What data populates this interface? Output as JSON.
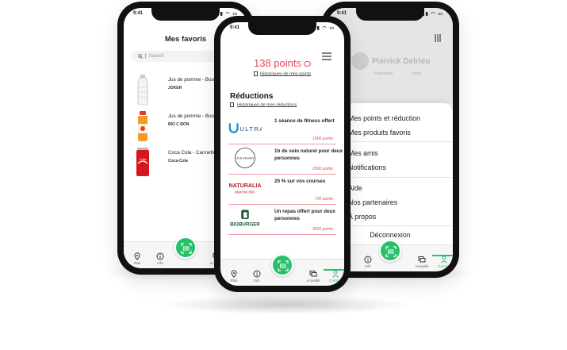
{
  "status_time": "9:41",
  "left_phone": {
    "title": "Mes favoris",
    "search_placeholder": "Search",
    "products": [
      {
        "name": "Jus de pomme - Bouteille plastique",
        "brand": "JOKER"
      },
      {
        "name": "Jus de pomme - Bouteille verre",
        "brand": "BIO C BON"
      },
      {
        "name": "Coca Cola - Cannette",
        "brand": "Coca-Cola"
      }
    ],
    "nav": {
      "plan": "Plan",
      "info": "Info",
      "actualite": "Actualité"
    }
  },
  "center_phone": {
    "points": "138 points",
    "history_link": "Historiques de mes points",
    "reductions_title": "Réductions",
    "reductions_link": "Historiques de mes réductions",
    "offers": [
      {
        "brand": "ULTRA",
        "description": "1 séance de fitness offert",
        "points": "1600 points"
      },
      {
        "brand": "ZEN DESIGN",
        "description": "1h de soin naturel pour deux personnes",
        "points": "2000 points"
      },
      {
        "brand": "NATURALIA Marché BIO",
        "description": "20 % sur vos courses",
        "points": "700 points"
      },
      {
        "brand": "BIOBURGER",
        "description": "Un repas offert pour deux personnes",
        "points": "3000 points"
      }
    ],
    "nav": {
      "plan": "Plan",
      "info": "Info",
      "actualite": "Actualité",
      "compte": "Compte"
    }
  },
  "right_phone": {
    "profile_name": "Pierrick Delrieu",
    "publication_label": "Publication",
    "amis_label": "Amis",
    "menu": [
      "Mes points et réduction",
      "Mes produits favoris",
      "Mes amis",
      "Notifications",
      "Aide",
      "Nos partenaires",
      "À propos"
    ],
    "logout": "Déconnexion",
    "nav": {
      "info": "Info",
      "actualite": "Actualité",
      "compte": "Compte"
    }
  },
  "colors": {
    "accent_green": "#27c16a",
    "accent_red": "#e14a5a"
  }
}
